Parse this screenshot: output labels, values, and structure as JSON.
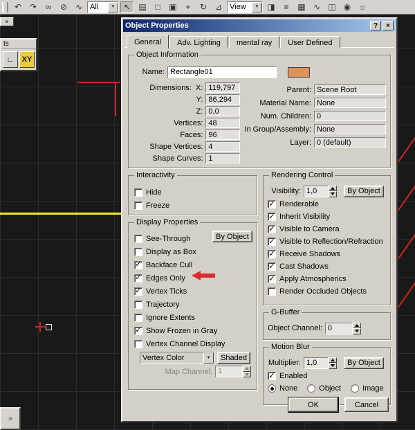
{
  "colors": {
    "swatch": "#df915a",
    "annotation_arrow": "#d92b2b",
    "titlebar_start": "#0a246a",
    "titlebar_end": "#a6caf0",
    "viewport_line_yellow": "#f2ef1d",
    "viewport_line_red": "#cc2424"
  },
  "toolbar": {
    "selection_filter": "All",
    "coord_system": "View",
    "icons": [
      {
        "glyph": "↶",
        "name": "undo"
      },
      {
        "glyph": "↷",
        "name": "redo"
      },
      {
        "glyph": "∞",
        "name": "select-and-link"
      },
      {
        "glyph": "⊘",
        "name": "unlink-selection"
      },
      {
        "glyph": "∿",
        "name": "bind-to-space-warp"
      },
      {
        "glyph": "↖",
        "name": "select-object",
        "pressed": true
      },
      {
        "glyph": "▤",
        "name": "select-by-name"
      },
      {
        "glyph": "□",
        "name": "rectangular-selection-region"
      },
      {
        "glyph": "▣",
        "name": "window-crossing"
      },
      {
        "glyph": "+",
        "name": "select-and-move"
      },
      {
        "glyph": "↻",
        "name": "select-and-rotate"
      },
      {
        "glyph": "⊿",
        "name": "select-and-scale"
      },
      {
        "glyph": "◨",
        "name": "mirror"
      },
      {
        "glyph": "≡",
        "name": "align"
      },
      {
        "glyph": "▦",
        "name": "layer-manager"
      },
      {
        "glyph": "∿",
        "name": "curve-editor"
      },
      {
        "glyph": "◫",
        "name": "schematic-view"
      },
      {
        "glyph": "◉",
        "name": "material-editor"
      },
      {
        "glyph": "☼",
        "name": "render-setup"
      }
    ]
  },
  "floating_toolbar": {
    "title": "ts",
    "button1_glyph": "∟",
    "xy_label": "XY"
  },
  "corner_glyph": "»",
  "chip_glyph": "≡",
  "dialog": {
    "title": "Object Properties",
    "help": "?",
    "close": "×",
    "tabs": [
      "General",
      "Adv. Lighting",
      "mental ray",
      "User Defined"
    ],
    "obj_info": {
      "legend": "Object Information",
      "name_label": "Name:",
      "name_value": "Rectangle01",
      "dimensions_label": "Dimensions:",
      "dim_rows": [
        {
          "label": "X:",
          "value": "119,797"
        },
        {
          "label": "Y:",
          "value": "86,294"
        },
        {
          "label": "Z:",
          "value": "0,0"
        }
      ],
      "geom_rows": [
        {
          "label": "Vertices:",
          "value": "48"
        },
        {
          "label": "Faces:",
          "value": "96"
        },
        {
          "label": "Shape Vertices:",
          "value": "4"
        },
        {
          "label": "Shape Curves:",
          "value": "1"
        }
      ],
      "right_rows": [
        {
          "label": "Parent:",
          "value": "Scene Root"
        },
        {
          "label": "Material Name:",
          "value": "None"
        },
        {
          "label": "Num. Children:",
          "value": "0"
        },
        {
          "label": "In Group/Assembly:",
          "value": "None"
        },
        {
          "label": "Layer:",
          "value": "0 (default)"
        }
      ]
    },
    "interactivity": {
      "legend": "Interactivity",
      "items": [
        {
          "label": "Hide",
          "checked": false
        },
        {
          "label": "Freeze",
          "checked": false
        }
      ]
    },
    "display": {
      "legend": "Display Properties",
      "by_object": "By Object",
      "items": [
        {
          "label": "See-Through",
          "checked": false
        },
        {
          "label": "Display as Box",
          "checked": false
        },
        {
          "label": "Backface Cull",
          "checked": true
        },
        {
          "label": "Edges Only",
          "checked": true
        },
        {
          "label": "Vertex Ticks",
          "checked": true
        },
        {
          "label": "Trajectory",
          "checked": false
        },
        {
          "label": "Ignore Extents",
          "checked": false
        },
        {
          "label": "Show Frozen in Gray",
          "checked": true
        },
        {
          "label": "Vertex Channel Display",
          "checked": false
        }
      ],
      "vertex_color_value": "Vertex Color",
      "shaded_label": "Shaded",
      "map_channel_label": "Map Channel:",
      "map_channel_value": "1"
    },
    "rendering": {
      "legend": "Rendering Control",
      "visibility_label": "Visibility:",
      "visibility_value": "1,0",
      "by_object": "By Object",
      "items": [
        {
          "label": "Renderable",
          "checked": true
        },
        {
          "label": "Inherit Visibility",
          "checked": true
        },
        {
          "label": "Visible to Camera",
          "checked": true
        },
        {
          "label": "Visible to Reflection/Refraction",
          "checked": true
        },
        {
          "label": "Receive Shadows",
          "checked": true
        },
        {
          "label": "Cast Shadows",
          "checked": true
        },
        {
          "label": "Apply Atmospherics",
          "checked": true
        },
        {
          "label": "Render Occluded Objects",
          "checked": false
        }
      ]
    },
    "gbuffer": {
      "legend": "G-Buffer",
      "object_channel_label": "Object Channel:",
      "object_channel_value": "0"
    },
    "motion_blur": {
      "legend": "Motion Blur",
      "multiplier_label": "Multiplier:",
      "multiplier_value": "1,0",
      "by_object": "By Object",
      "enabled_label": "Enabled",
      "enabled_checked": true,
      "options": [
        {
          "label": "None",
          "selected": true
        },
        {
          "label": "Object",
          "selected": false
        },
        {
          "label": "Image",
          "selected": false
        }
      ]
    },
    "ok": "OK",
    "cancel": "Cancel"
  }
}
